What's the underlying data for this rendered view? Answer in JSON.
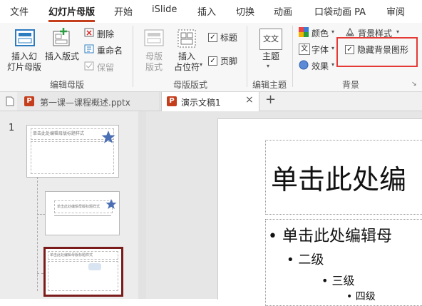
{
  "tabs": [
    "文件",
    "幻灯片母版",
    "开始",
    "iSlide",
    "插入",
    "切换",
    "动画",
    "口袋动画 PA",
    "审阅"
  ],
  "groups": {
    "edit_master": {
      "label": "编辑母版",
      "insert_master": "插入幻\n灯片母版",
      "insert_layout": "插入版式",
      "delete": "删除",
      "rename": "重命名",
      "preserve": "保留"
    },
    "master_layout": {
      "label": "母版版式",
      "master_layout_btn": "母版\n版式",
      "insert_placeholder": "插入\n占位符",
      "title_check": "标题",
      "footer_check": "页脚"
    },
    "edit_theme": {
      "label": "编辑主题",
      "theme": "主题",
      "theme_icon_text": "文文"
    },
    "background": {
      "label": "背景",
      "colors": "颜色",
      "fonts": "字体",
      "effects": "效果",
      "bg_style": "背景样式",
      "hide_bg": "隐藏背景图形"
    }
  },
  "file_tabs": [
    {
      "icon_text": "P",
      "name": "第一课—课程概述.pptx"
    },
    {
      "icon_text": "P",
      "name": "演示文稿1"
    }
  ],
  "slide_number": "1",
  "thumb_text": "单击此处编辑母版标题样式",
  "slide": {
    "title": "单击此处编",
    "bullet1": "• 单击此处编辑母",
    "bullet2": "• 二级",
    "bullet3": "• 三级",
    "bullet4": "• 四级"
  },
  "colors": {
    "accent": "#c43e1c",
    "highlight": "#e53935",
    "selected_thumb": "#7b1c1c"
  }
}
